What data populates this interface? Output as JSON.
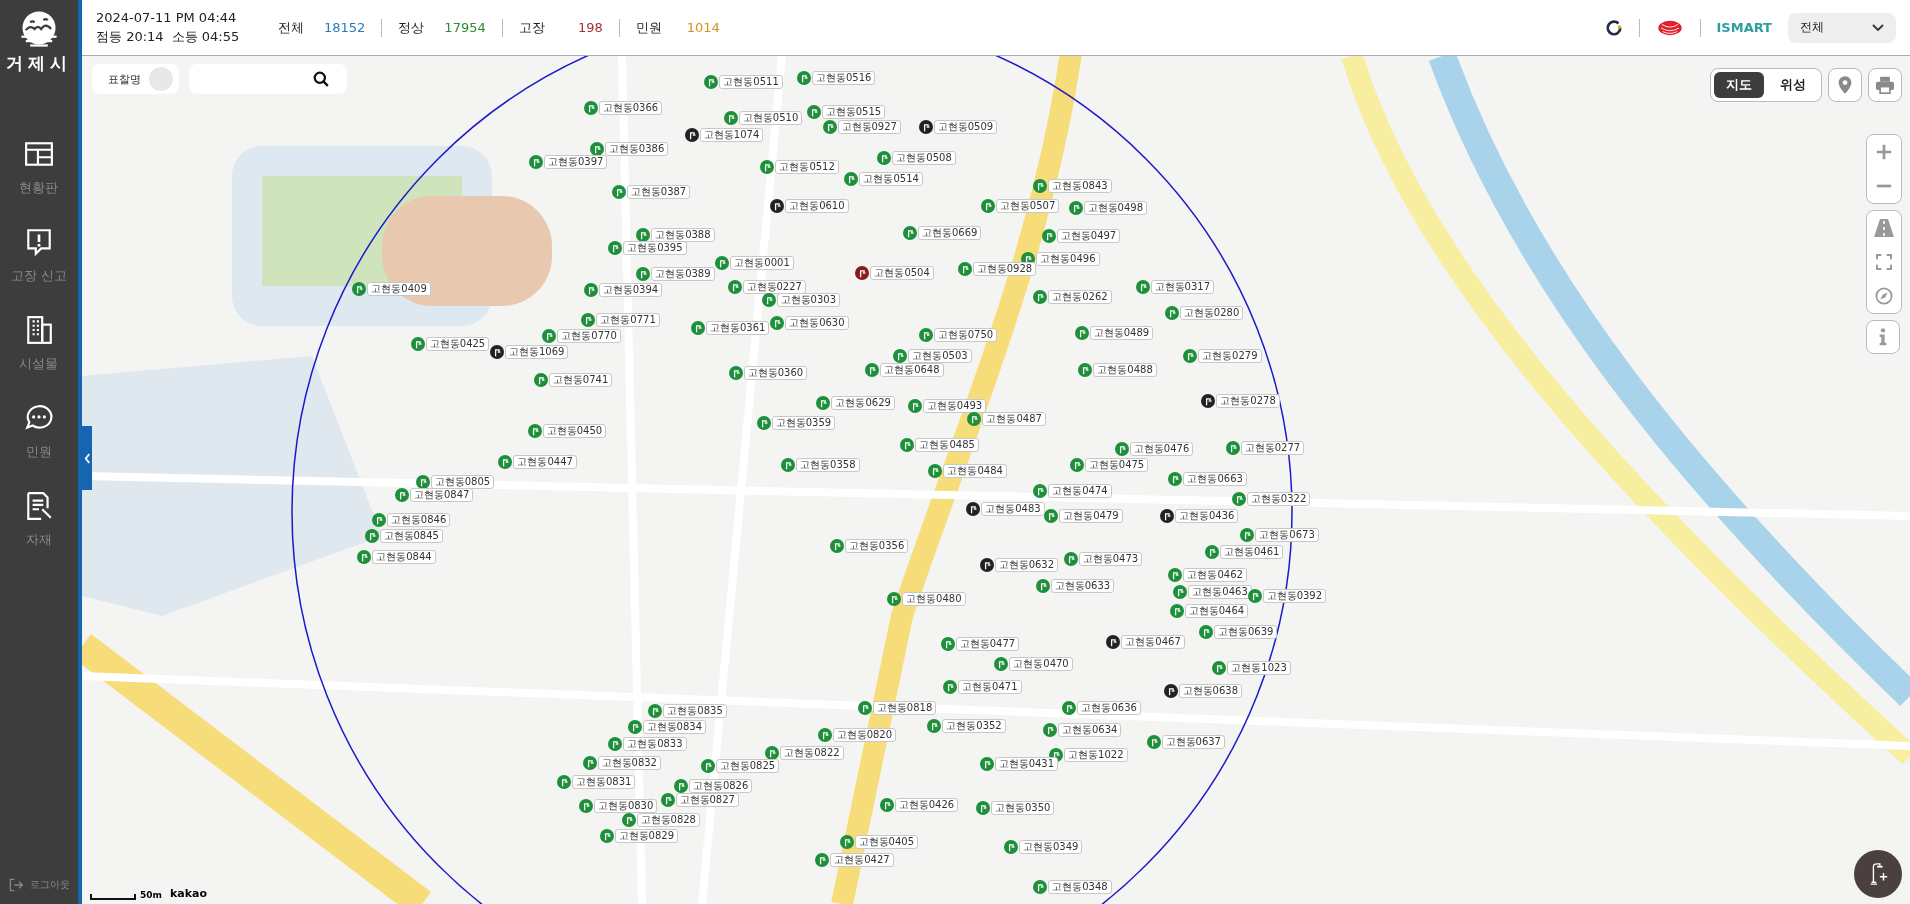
{
  "header": {
    "datetime": "2024-07-11 PM 04:44",
    "lamp_on": "점등 20:14",
    "lamp_off": "소등 04:55",
    "stats": [
      {
        "label": "전체",
        "value": "18152",
        "color": "#2a7ab8"
      },
      {
        "label": "정상",
        "value": "17954",
        "color": "#2e8b2e"
      },
      {
        "label": "고장",
        "value": "198",
        "color": "#a83232"
      },
      {
        "label": "민원",
        "value": "1014",
        "color": "#d4921e"
      }
    ],
    "brand": "ISMART",
    "region_select": {
      "value": "전체"
    }
  },
  "sidebar": {
    "logo_text": "거제시",
    "items": [
      {
        "label": "현황판",
        "kind": "dashboard"
      },
      {
        "label": "고장 신고",
        "kind": "report"
      },
      {
        "label": "시설물",
        "kind": "facility"
      },
      {
        "label": "민원",
        "kind": "complaint"
      },
      {
        "label": "자재",
        "kind": "material"
      }
    ],
    "logout": "로그아웃"
  },
  "map": {
    "search": {
      "toggle_label": "표찰명",
      "toggle_on": false
    },
    "view_tabs": [
      {
        "label": "지도",
        "selected": true
      },
      {
        "label": "위성",
        "selected": false
      }
    ],
    "scale": "50m",
    "attribution": "kakao",
    "markers": [
      {
        "label": "고현동0511",
        "color": "#1e8f3a"
      },
      {
        "label": "고현동0516",
        "color": "#1e8f3a"
      },
      {
        "label": "고현동0366",
        "color": "#1e8f3a"
      },
      {
        "label": "고현동0510",
        "color": "#1e8f3a"
      },
      {
        "label": "고현동0515",
        "color": "#1e8f3a"
      },
      {
        "label": "고현동1074",
        "color": "#222222"
      },
      {
        "label": "고현동0927",
        "color": "#1e8f3a"
      },
      {
        "label": "고현동0509",
        "color": "#222222"
      },
      {
        "label": "고현동0386",
        "color": "#1e8f3a"
      },
      {
        "label": "고현동0397",
        "color": "#1e8f3a"
      },
      {
        "label": "고현동0512",
        "color": "#1e8f3a"
      },
      {
        "label": "고현동0508",
        "color": "#1e8f3a"
      },
      {
        "label": "고현동0514",
        "color": "#1e8f3a"
      },
      {
        "label": "고현동0387",
        "color": "#1e8f3a"
      },
      {
        "label": "고현동0843",
        "color": "#1e8f3a"
      },
      {
        "label": "고현동0610",
        "color": "#222222"
      },
      {
        "label": "고현동0507",
        "color": "#1e8f3a"
      },
      {
        "label": "고현동0498",
        "color": "#1e8f3a"
      },
      {
        "label": "고현동0388",
        "color": "#1e8f3a"
      },
      {
        "label": "고현동0669",
        "color": "#1e8f3a"
      },
      {
        "label": "고현동0497",
        "color": "#1e8f3a"
      },
      {
        "label": "고현동0395",
        "color": "#1e8f3a"
      },
      {
        "label": "고현동0001",
        "color": "#1e8f3a"
      },
      {
        "label": "고현동0496",
        "color": "#1e8f3a"
      },
      {
        "label": "고현동0389",
        "color": "#1e8f3a"
      },
      {
        "label": "고현동0504",
        "color": "#8b1a1a"
      },
      {
        "label": "고현동0928",
        "color": "#1e8f3a"
      },
      {
        "label": "고현동0409",
        "color": "#1e8f3a"
      },
      {
        "label": "고현동0394",
        "color": "#1e8f3a"
      },
      {
        "label": "고현동0227",
        "color": "#1e8f3a"
      },
      {
        "label": "고현동0317",
        "color": "#1e8f3a"
      },
      {
        "label": "고현동0303",
        "color": "#1e8f3a"
      },
      {
        "label": "고현동0262",
        "color": "#1e8f3a"
      },
      {
        "label": "고현동0280",
        "color": "#1e8f3a"
      },
      {
        "label": "고현동0771",
        "color": "#1e8f3a"
      },
      {
        "label": "고현동0361",
        "color": "#1e8f3a"
      },
      {
        "label": "고현동0630",
        "color": "#1e8f3a"
      },
      {
        "label": "고현동0770",
        "color": "#1e8f3a"
      },
      {
        "label": "고현동0750",
        "color": "#1e8f3a"
      },
      {
        "label": "고현동0489",
        "color": "#1e8f3a"
      },
      {
        "label": "고현동0425",
        "color": "#1e8f3a"
      },
      {
        "label": "고현동1069",
        "color": "#222222"
      },
      {
        "label": "고현동0503",
        "color": "#1e8f3a"
      },
      {
        "label": "고현동0279",
        "color": "#1e8f3a"
      },
      {
        "label": "고현동0360",
        "color": "#1e8f3a"
      },
      {
        "label": "고현동0648",
        "color": "#1e8f3a"
      },
      {
        "label": "고현동0488",
        "color": "#1e8f3a"
      },
      {
        "label": "고현동0741",
        "color": "#1e8f3a"
      },
      {
        "label": "고현동0629",
        "color": "#1e8f3a"
      },
      {
        "label": "고현동0493",
        "color": "#1e8f3a"
      },
      {
        "label": "고현동0278",
        "color": "#222222"
      },
      {
        "label": "고현동0359",
        "color": "#1e8f3a"
      },
      {
        "label": "고현동0487",
        "color": "#1e8f3a"
      },
      {
        "label": "고현동0450",
        "color": "#1e8f3a"
      },
      {
        "label": "고현동0485",
        "color": "#1e8f3a"
      },
      {
        "label": "고현동0476",
        "color": "#1e8f3a"
      },
      {
        "label": "고현동0277",
        "color": "#1e8f3a"
      },
      {
        "label": "고현동0447",
        "color": "#1e8f3a"
      },
      {
        "label": "고현동0358",
        "color": "#1e8f3a"
      },
      {
        "label": "고현동0475",
        "color": "#1e8f3a"
      },
      {
        "label": "고현동0484",
        "color": "#1e8f3a"
      },
      {
        "label": "고현동0805",
        "color": "#1e8f3a"
      },
      {
        "label": "고현동0663",
        "color": "#1e8f3a"
      },
      {
        "label": "고현동0847",
        "color": "#1e8f3a"
      },
      {
        "label": "고현동0474",
        "color": "#1e8f3a"
      },
      {
        "label": "고현동0322",
        "color": "#1e8f3a"
      },
      {
        "label": "고현동0483",
        "color": "#222222"
      },
      {
        "label": "고현동0846",
        "color": "#1e8f3a"
      },
      {
        "label": "고현동0479",
        "color": "#1e8f3a"
      },
      {
        "label": "고현동0436",
        "color": "#222222"
      },
      {
        "label": "고현동0845",
        "color": "#1e8f3a"
      },
      {
        "label": "고현동0673",
        "color": "#1e8f3a"
      },
      {
        "label": "고현동0356",
        "color": "#1e8f3a"
      },
      {
        "label": "고현동0844",
        "color": "#1e8f3a"
      },
      {
        "label": "고현동0632",
        "color": "#222222"
      },
      {
        "label": "고현동0473",
        "color": "#1e8f3a"
      },
      {
        "label": "고현동0461",
        "color": "#1e8f3a"
      },
      {
        "label": "고현동0462",
        "color": "#1e8f3a"
      },
      {
        "label": "고현동0633",
        "color": "#1e8f3a"
      },
      {
        "label": "고현동0480",
        "color": "#1e8f3a"
      },
      {
        "label": "고현동0463",
        "color": "#1e8f3a"
      },
      {
        "label": "고현동0392",
        "color": "#1e8f3a"
      },
      {
        "label": "고현동0464",
        "color": "#1e8f3a"
      },
      {
        "label": "고현동0639",
        "color": "#1e8f3a"
      },
      {
        "label": "고현동0477",
        "color": "#1e8f3a"
      },
      {
        "label": "고현동0467",
        "color": "#222222"
      },
      {
        "label": "고현동0470",
        "color": "#1e8f3a"
      },
      {
        "label": "고현동1023",
        "color": "#1e8f3a"
      },
      {
        "label": "고현동0471",
        "color": "#1e8f3a"
      },
      {
        "label": "고현동0638",
        "color": "#222222"
      },
      {
        "label": "고현동0835",
        "color": "#1e8f3a"
      },
      {
        "label": "고현동0818",
        "color": "#1e8f3a"
      },
      {
        "label": "고현동0636",
        "color": "#1e8f3a"
      },
      {
        "label": "고현동0834",
        "color": "#1e8f3a"
      },
      {
        "label": "고현동0352",
        "color": "#1e8f3a"
      },
      {
        "label": "고현동0634",
        "color": "#1e8f3a"
      },
      {
        "label": "고현동0820",
        "color": "#1e8f3a"
      },
      {
        "label": "고현동0833",
        "color": "#1e8f3a"
      },
      {
        "label": "고현동0637",
        "color": "#1e8f3a"
      },
      {
        "label": "고현동0822",
        "color": "#1e8f3a"
      },
      {
        "label": "고현동1022",
        "color": "#1e8f3a"
      },
      {
        "label": "고현동0832",
        "color": "#1e8f3a"
      },
      {
        "label": "고현동0825",
        "color": "#1e8f3a"
      },
      {
        "label": "고현동0431",
        "color": "#1e8f3a"
      },
      {
        "label": "고현동0831",
        "color": "#1e8f3a"
      },
      {
        "label": "고현동0826",
        "color": "#1e8f3a"
      },
      {
        "label": "고현동0830",
        "color": "#1e8f3a"
      },
      {
        "label": "고현동0827",
        "color": "#1e8f3a"
      },
      {
        "label": "고현동0426",
        "color": "#1e8f3a"
      },
      {
        "label": "고현동0350",
        "color": "#1e8f3a"
      },
      {
        "label": "고현동0828",
        "color": "#1e8f3a"
      },
      {
        "label": "고현동0829",
        "color": "#1e8f3a"
      },
      {
        "label": "고현동0405",
        "color": "#1e8f3a"
      },
      {
        "label": "고현동0349",
        "color": "#1e8f3a"
      },
      {
        "label": "고현동0427",
        "color": "#1e8f3a"
      },
      {
        "label": "고현동0348",
        "color": "#1e8f3a"
      }
    ]
  }
}
